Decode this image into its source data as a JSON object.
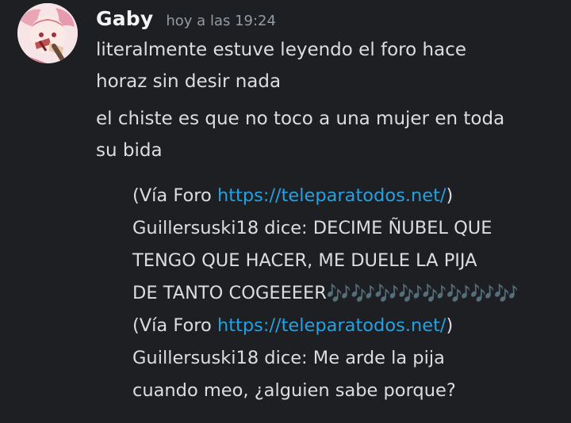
{
  "message": {
    "author": "Gaby",
    "timestamp": "hoy a las 19:24",
    "paragraph1": {
      "line1": "literalmente estuve leyendo el foro hace",
      "line2": "horaz sin desir nada"
    },
    "paragraph2": {
      "line1": "el chiste es que no toco a una mujer en toda",
      "line2": "su bida"
    },
    "quote1": {
      "prefix": "(Vía Foro ",
      "link": "https://teleparatodos.net/",
      "suffix": ")",
      "line2": "Guillersuski18 dice: DECIME ÑUBEL QUE",
      "line3": "TENGO QUE HACER, ME DUELE LA PIJA",
      "line4": "DE TANTO COGEEEER",
      "emoji": "🎶🎶🎶🎶🎶🎶🎶🎶"
    },
    "quote2": {
      "prefix": "(Vía Foro ",
      "link": "https://teleparatodos.net/",
      "suffix": ")",
      "line2": "Guillersuski18 dice: Me arde la pija",
      "line3": "cuando meo, ¿alguien sabe porque?"
    }
  },
  "colors": {
    "background": "#1e1f22",
    "text": "#dbdee1",
    "username": "#f2f3f5",
    "timestamp": "#949ba4",
    "link": "#22a2e5",
    "notes_emoji": "#34a4f2"
  },
  "icons": {
    "avatar": "avatar-image",
    "notes_emoji": "musical-notes-emoji"
  }
}
